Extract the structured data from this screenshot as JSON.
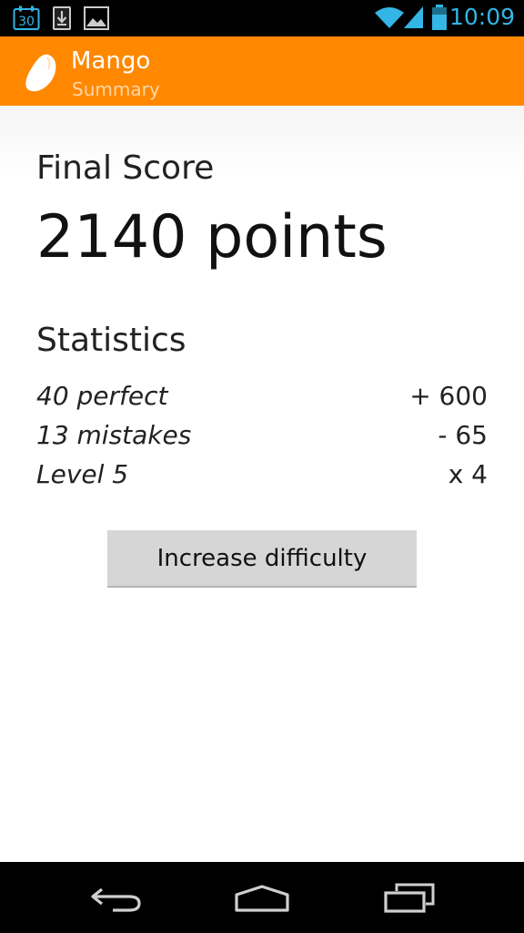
{
  "status_bar": {
    "time": "10:09",
    "calendar_date": "30",
    "accent_color": "#33b5e5",
    "icons": [
      "calendar-icon",
      "download-icon",
      "image-icon",
      "wifi-icon",
      "signal-icon",
      "battery-icon"
    ]
  },
  "action_bar": {
    "title": "Mango",
    "subtitle": "Summary",
    "background_color": "#ff8800",
    "icon": "mango-icon"
  },
  "summary": {
    "final_score_label": "Final Score",
    "score": "2140 points",
    "statistics_heading": "Statistics",
    "stats": [
      {
        "label": "40 perfect",
        "value": "+ 600"
      },
      {
        "label": "13 mistakes",
        "value": "- 65"
      },
      {
        "label": "Level 5",
        "value": "x 4"
      }
    ],
    "increase_button_label": "Increase difficulty"
  },
  "nav_bar": {
    "buttons": [
      "back-icon",
      "home-icon",
      "recent-apps-icon"
    ]
  }
}
